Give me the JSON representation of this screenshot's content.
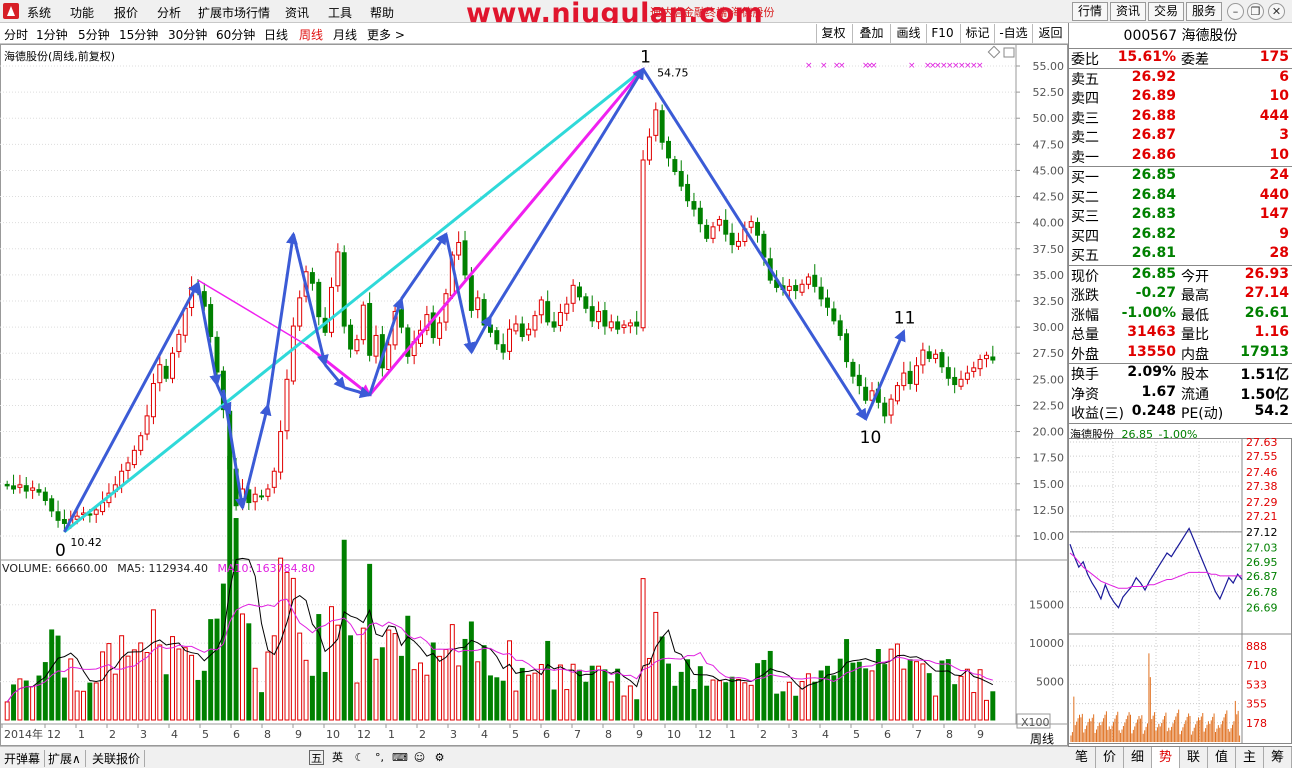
{
  "menu": {
    "items": [
      "系统",
      "功能",
      "报价",
      "分析",
      "扩展市场行情",
      "资讯",
      "工具",
      "帮助"
    ],
    "watermark": "www.niugulan.com",
    "title_text": "通达信金融终端   海德股份",
    "right_buttons": [
      "行情",
      "资讯",
      "交易",
      "服务"
    ]
  },
  "periods": {
    "items": [
      "分时",
      "1分钟",
      "5分钟",
      "15分钟",
      "30分钟",
      "60分钟",
      "日线",
      "周线",
      "月线",
      "更多 >"
    ],
    "active": "周线"
  },
  "tools": [
    "复权",
    "叠加",
    "画线",
    "F10",
    "标记",
    "-自选",
    "返回"
  ],
  "chart": {
    "caption": "海德股份(周线,前复权)",
    "volume_label": "VOLUME: 66660.00",
    "ma5_label": "MA5: 112934.40",
    "ma10_label": "MA10: 163784.80",
    "x_multiplier": "X100",
    "period_label": "周线",
    "price_ticks": [
      "55.00",
      "52.50",
      "50.00",
      "47.50",
      "45.00",
      "42.50",
      "40.00",
      "37.50",
      "35.00",
      "32.50",
      "30.00",
      "27.50",
      "25.00",
      "22.50",
      "20.00",
      "17.50",
      "15.00",
      "12.50",
      "10.00"
    ],
    "volume_ticks": [
      "15000",
      "10000",
      "5000"
    ],
    "x_labels": [
      "2014年",
      "12",
      "1",
      "2",
      "3",
      "4",
      "5",
      "6",
      "8",
      "9",
      "10",
      "12",
      "1",
      "2",
      "3",
      "4",
      "5",
      "6",
      "7",
      "8",
      "9",
      "10",
      "12",
      "1",
      "2",
      "3",
      "4",
      "5",
      "6",
      "7",
      "8",
      "9"
    ],
    "annotations": {
      "wave_0": "0",
      "wave_1": "1",
      "wave_10": "10",
      "wave_11": "11",
      "low_price": "10.42",
      "high_price": "54.75"
    },
    "colors": {
      "up": "#e00000",
      "down": "#008000",
      "blue_arrow": "#3b5bd6",
      "cyan_line": "#2fd9d9",
      "magenta_line": "#f020f0",
      "ma5": "#000000",
      "ma10": "#e020e0"
    }
  },
  "chart_data": {
    "type": "candlestick",
    "title": "海德股份(周线,前复权)",
    "ylim": [
      10,
      55
    ],
    "marked_low": 10.42,
    "marked_high": 54.75,
    "waves": [
      {
        "label": "0",
        "price": 10.42
      },
      {
        "label": "1",
        "price": 54.75
      },
      {
        "label": "10",
        "price": 21.0
      },
      {
        "label": "11",
        "price": 29.6
      }
    ],
    "series": [
      {
        "name": "VOLUME",
        "last": 66660.0
      },
      {
        "name": "MA5",
        "last": 112934.4
      },
      {
        "name": "MA10",
        "last": 163784.8
      }
    ],
    "closes": [
      14.8,
      14.5,
      14.9,
      14.3,
      14.6,
      14.2,
      13.4,
      12.4,
      11.5,
      11.2,
      11.6,
      11.9,
      12.2,
      12.0,
      12.5,
      13.2,
      14.1,
      14.9,
      16.2,
      17.0,
      18.2,
      19.6,
      21.5,
      24.6,
      26.4,
      25.1,
      27.5,
      29.3,
      31.8,
      33.8,
      33.4,
      32.0,
      29.1,
      25.7,
      22.1,
      16.4,
      12.9,
      14.5,
      13.2,
      14.0,
      13.8,
      14.5,
      16.2,
      20.0,
      25.0,
      30.1,
      32.8,
      35.3,
      34.2,
      31.0,
      29.5,
      33.8,
      37.2,
      30.1,
      27.9,
      28.8,
      32.1,
      27.3,
      29.2,
      26.1,
      28.3,
      31.5,
      30.0,
      27.2,
      28.6,
      29.7,
      31.2,
      29.0,
      30.4,
      33.2,
      36.9,
      38.1,
      35.0,
      31.6,
      32.8,
      30.2,
      29.5,
      28.4,
      27.6,
      29.8,
      30.3,
      29.1,
      29.8,
      31.1,
      32.6,
      30.5,
      30.0,
      31.4,
      32.2,
      34.0,
      32.9,
      31.8,
      30.6,
      31.5,
      30.1,
      30.5,
      29.8,
      30.2,
      30.4,
      30.1,
      46.0,
      48.2,
      50.8,
      47.7,
      46.2,
      44.9,
      43.5,
      42.1,
      41.3,
      39.9,
      38.5,
      39.6,
      40.3,
      38.9,
      37.9,
      38.2,
      39.4,
      40.1,
      38.8,
      36.7,
      34.5,
      33.8,
      33.6,
      33.9,
      33.5,
      34.1,
      34.8,
      33.9,
      32.7,
      31.9,
      30.6,
      29.2,
      26.7,
      25.3,
      24.4,
      23.0,
      23.9,
      22.8,
      21.5,
      23.1,
      24.4,
      25.6,
      24.6,
      26.3,
      27.8,
      27.0,
      27.4,
      26.2,
      25.1,
      24.5,
      25.0,
      25.6,
      26.1,
      26.9,
      27.3,
      26.85
    ]
  },
  "quote": {
    "code": "000567",
    "name": "海德股份",
    "wei_bi_label": "委比",
    "wei_bi": "15.61%",
    "wei_cha_label": "委差",
    "wei_cha": "175",
    "asks": [
      {
        "label": "卖五",
        "price": "26.92",
        "vol": "6"
      },
      {
        "label": "卖四",
        "price": "26.89",
        "vol": "10"
      },
      {
        "label": "卖三",
        "price": "26.88",
        "vol": "444"
      },
      {
        "label": "卖二",
        "price": "26.87",
        "vol": "3"
      },
      {
        "label": "卖一",
        "price": "26.86",
        "vol": "10"
      }
    ],
    "bids": [
      {
        "label": "买一",
        "price": "26.85",
        "vol": "24"
      },
      {
        "label": "买二",
        "price": "26.84",
        "vol": "440"
      },
      {
        "label": "买三",
        "price": "26.83",
        "vol": "147"
      },
      {
        "label": "买四",
        "price": "26.82",
        "vol": "9"
      },
      {
        "label": "买五",
        "price": "26.81",
        "vol": "28"
      }
    ],
    "stats1": [
      {
        "l1": "现价",
        "v1": "26.85",
        "c1": "green",
        "l2": "今开",
        "v2": "26.93",
        "c2": "red"
      },
      {
        "l1": "涨跌",
        "v1": "-0.27",
        "c1": "green",
        "l2": "最高",
        "v2": "27.14",
        "c2": "red"
      },
      {
        "l1": "涨幅",
        "v1": "-1.00%",
        "c1": "green",
        "l2": "最低",
        "v2": "26.61",
        "c2": "green"
      },
      {
        "l1": "总量",
        "v1": "31463",
        "c1": "red",
        "l2": "量比",
        "v2": "1.16",
        "c2": "red"
      },
      {
        "l1": "外盘",
        "v1": "13550",
        "c1": "red",
        "l2": "内盘",
        "v2": "17913",
        "c2": "green"
      }
    ],
    "stats2": [
      {
        "l1": "换手",
        "v1": "2.09%",
        "l2": "股本",
        "v2": "1.51亿"
      },
      {
        "l1": "净资",
        "v1": "1.67",
        "l2": "流通",
        "v2": "1.50亿"
      },
      {
        "l1": "收益(三)",
        "v1": "0.248",
        "l2": "PE(动)",
        "v2": "54.2"
      }
    ]
  },
  "mini_chart": {
    "title": "海德股份",
    "price": "26.85",
    "change": "-1.00%",
    "price_ticks": [
      "27.63",
      "27.55",
      "27.46",
      "27.38",
      "27.29",
      "27.21",
      "27.12",
      "27.03",
      "26.95",
      "26.87",
      "26.78",
      "26.69"
    ],
    "volume_ticks": [
      "888",
      "710",
      "533",
      "355",
      "178"
    ]
  },
  "status": {
    "buttons": [
      "开弹幕",
      "扩展∧",
      "关联报价"
    ],
    "ime": [
      "英"
    ]
  },
  "bottom_tabs": [
    "笔",
    "价",
    "细",
    "势",
    "联",
    "值",
    "主",
    "筹"
  ],
  "bottom_active": "势"
}
